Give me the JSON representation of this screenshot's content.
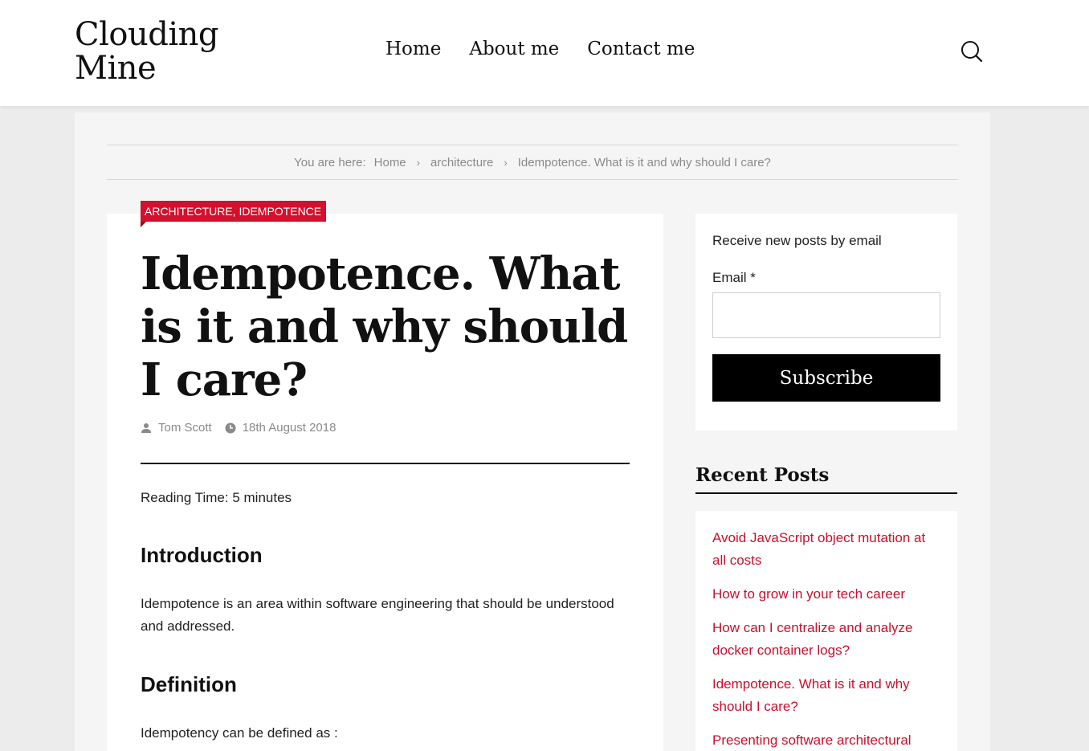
{
  "site": {
    "title_line1": "Clouding",
    "title_line2": "Mine"
  },
  "nav": {
    "items": [
      {
        "label": "Home"
      },
      {
        "label": "About me"
      },
      {
        "label": "Contact me"
      }
    ],
    "search_icon": "search-icon"
  },
  "breadcrumb": {
    "prefix": "You are here:",
    "items": [
      {
        "label": "Home"
      },
      {
        "label": "architecture"
      },
      {
        "label": "Idempotence. What is it and why should I care?"
      }
    ],
    "separator": "›"
  },
  "post": {
    "categories": "ARCHITECTURE, IDEMPOTENCE",
    "title": "Idempotence. What is it and why should I care?",
    "author": "Tom Scott",
    "date": "18th August 2018",
    "reading_time": "Reading Time: 5 minutes",
    "sections": [
      {
        "heading": "Introduction",
        "text": "Idempotence is an area within software engineering that should be understood and addressed."
      },
      {
        "heading": "Definition",
        "text": "Idempotency can be defined as :"
      }
    ]
  },
  "subscribe": {
    "intro": "Receive new posts by email",
    "email_label": "Email *",
    "email_value": "",
    "button_label": "Subscribe"
  },
  "recent_posts": {
    "title": "Recent Posts",
    "items": [
      {
        "label": "Avoid JavaScript object mutation at all costs"
      },
      {
        "label": "How to grow in your tech career"
      },
      {
        "label": "How can I centralize and analyze docker container logs?"
      },
      {
        "label": "Idempotence. What is it and why should I care?"
      },
      {
        "label": "Presenting software architectural"
      }
    ]
  },
  "colors": {
    "accent": "#c8102e",
    "badge": "#d3102d",
    "page_bg": "#ececec",
    "content_bg": "#f5f5f5"
  }
}
